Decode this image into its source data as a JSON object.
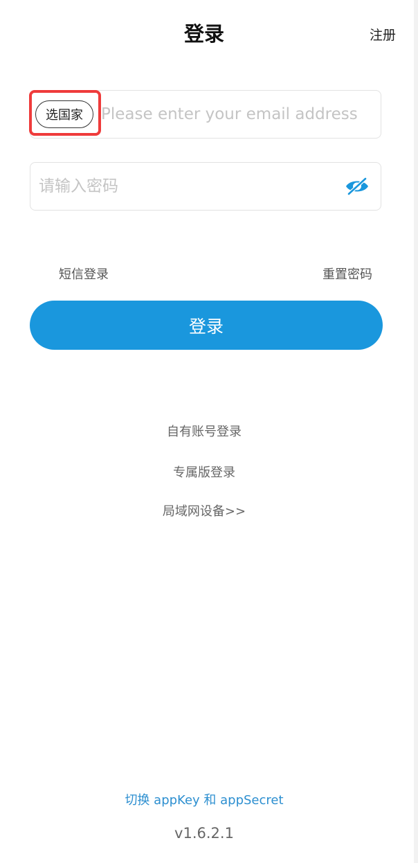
{
  "header": {
    "title": "登录",
    "register_label": "注册"
  },
  "email_field": {
    "country_button_label": "选国家",
    "placeholder": "Please enter your email address",
    "value": ""
  },
  "password_field": {
    "placeholder": "请输入密码",
    "value": "",
    "visibility_icon": "eye-hidden-icon"
  },
  "options": {
    "sms_login_label": "短信登录",
    "reset_password_label": "重置密码"
  },
  "login_button": {
    "label": "登录"
  },
  "alternate_logins": {
    "own_account_label": "自有账号登录",
    "exclusive_edition_label": "专属版登录",
    "lan_device_label": "局域网设备>>"
  },
  "footer": {
    "switch_label": "切换 appKey 和 appSecret",
    "version": "v1.6.2.1"
  },
  "colors": {
    "accent": "#1a97dd",
    "highlight": "#ef3b3b",
    "link": "#2d8fd0"
  }
}
